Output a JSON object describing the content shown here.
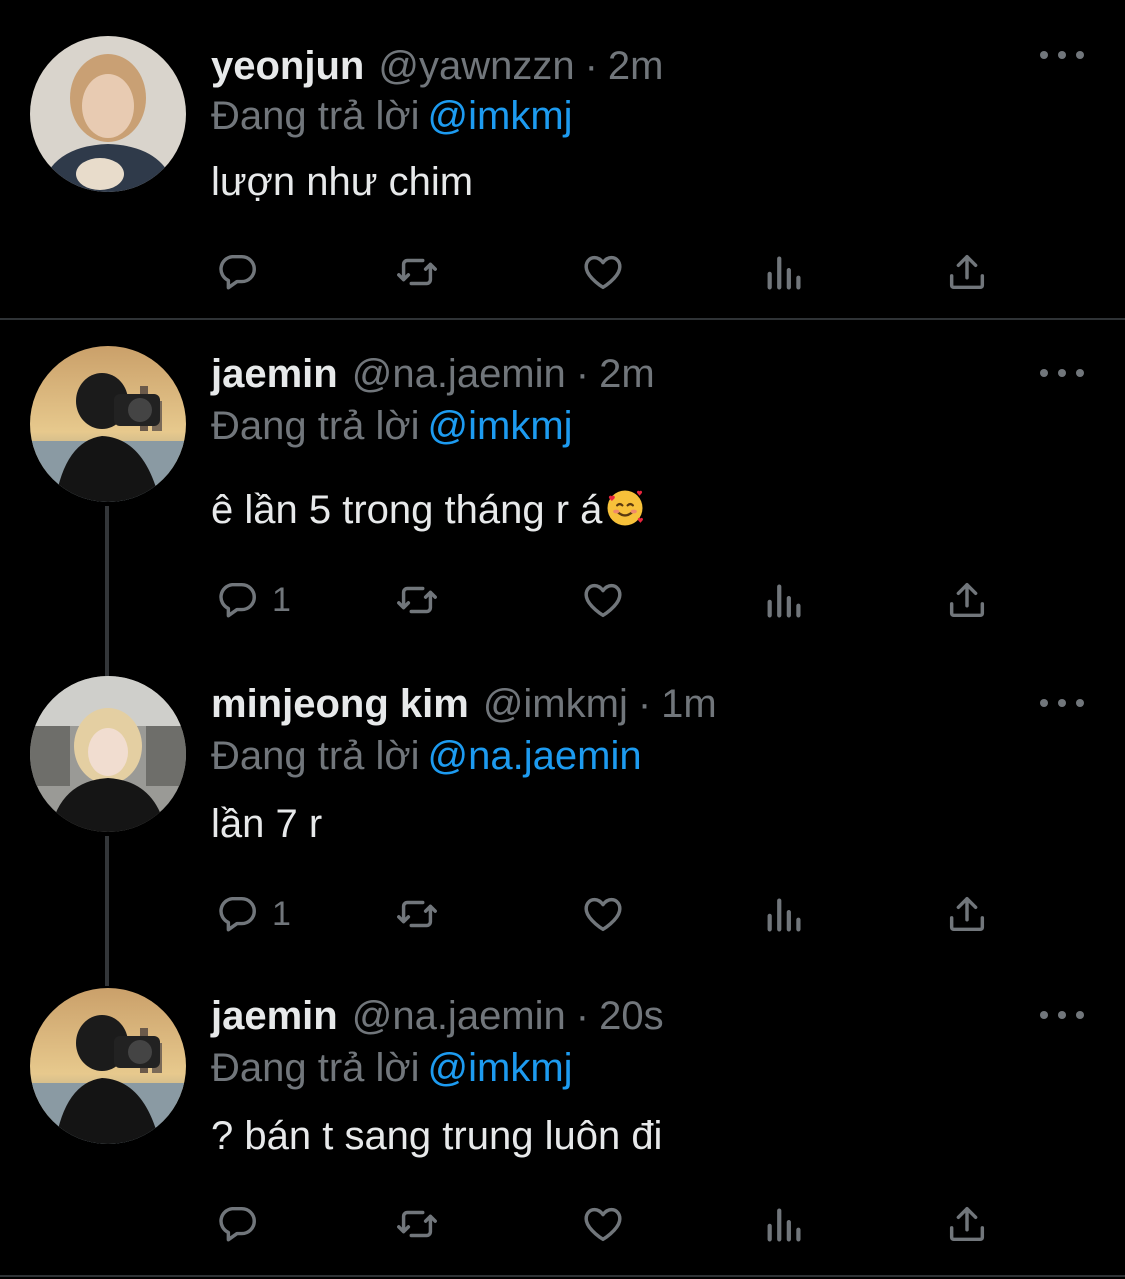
{
  "tweets": [
    {
      "name": "yeonjun",
      "handle": "@yawnzzn",
      "separator": "·",
      "time": "2m",
      "replying_prefix": "Đang trả lời",
      "replying_to": "@imkmj",
      "text": "lượn như chim",
      "reply_count": "",
      "avatar_desc": "avatar-yeonjun"
    },
    {
      "name": "jaemin",
      "handle": "@na.jaemin",
      "separator": "·",
      "time": "2m",
      "replying_prefix": "Đang trả lời",
      "replying_to": "@imkmj",
      "text": "ê lần 5 trong tháng r á",
      "reply_count": "1",
      "avatar_desc": "avatar-jaemin"
    },
    {
      "name": "minjeong kim",
      "handle": "@imkmj",
      "separator": "·",
      "time": "1m",
      "replying_prefix": "Đang trả lời",
      "replying_to": "@na.jaemin",
      "text": "lần 7 r",
      "reply_count": "1",
      "avatar_desc": "avatar-minjeong"
    },
    {
      "name": "jaemin",
      "handle": "@na.jaemin",
      "separator": "·",
      "time": "20s",
      "replying_prefix": "Đang trả lời",
      "replying_to": "@imkmj",
      "text": "? bán t sang trung luôn đi",
      "reply_count": "",
      "avatar_desc": "avatar-jaemin"
    }
  ],
  "icons": {
    "reply": "reply-icon",
    "retweet": "retweet-icon",
    "like": "heart-icon",
    "views": "views-icon",
    "share": "share-icon",
    "more": "more-icon",
    "emoji": "smiling-face-with-hearts-icon"
  },
  "colors": {
    "background": "#000000",
    "text": "#e7e9ea",
    "muted": "#71767b",
    "link": "#1d9bf0",
    "divider": "#2f3336"
  }
}
